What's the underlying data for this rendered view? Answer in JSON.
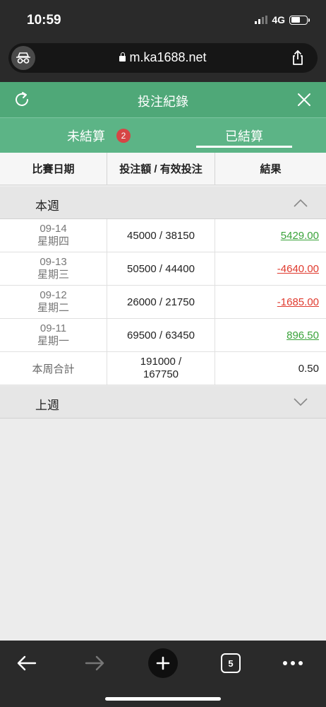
{
  "status": {
    "time": "10:59",
    "network": "4G"
  },
  "browser": {
    "url": "m.ka1688.net"
  },
  "app": {
    "title": "投注紀錄"
  },
  "tabs": {
    "pending_label": "未結算",
    "pending_badge": "2",
    "settled_label": "已結算"
  },
  "columns": {
    "date": "比賽日期",
    "amount": "投注額 / 有效投注",
    "result": "結果"
  },
  "this_week": {
    "label": "本週",
    "rows": [
      {
        "date": "09-14",
        "weekday": "星期四",
        "amount": "45000 / 38150",
        "result": "5429.00"
      },
      {
        "date": "09-13",
        "weekday": "星期三",
        "amount": "50500 / 44400",
        "result": "-4640.00"
      },
      {
        "date": "09-12",
        "weekday": "星期二",
        "amount": "26000 / 21750",
        "result": "-1685.00"
      },
      {
        "date": "09-11",
        "weekday": "星期一",
        "amount": "69500 / 63450",
        "result": "896.50"
      }
    ],
    "total": {
      "label": "本周合計",
      "amount_line1": "191000 /",
      "amount_line2": "167750",
      "result": "0.50"
    }
  },
  "last_week": {
    "label": "上週"
  },
  "toolbar": {
    "tabs_count": "5"
  },
  "colors": {
    "header": "#4fa878",
    "tabs": "#5cb486",
    "positive": "#3aa33a",
    "negative": "#e03a2e",
    "badge": "#d64545"
  },
  "icons": [
    "incognito-icon",
    "lock-icon",
    "share-icon",
    "refresh-icon",
    "close-icon",
    "chevron-up-icon",
    "chevron-down-icon",
    "back-arrow-icon",
    "forward-arrow-icon",
    "plus-icon",
    "tabs-icon",
    "more-icon"
  ]
}
